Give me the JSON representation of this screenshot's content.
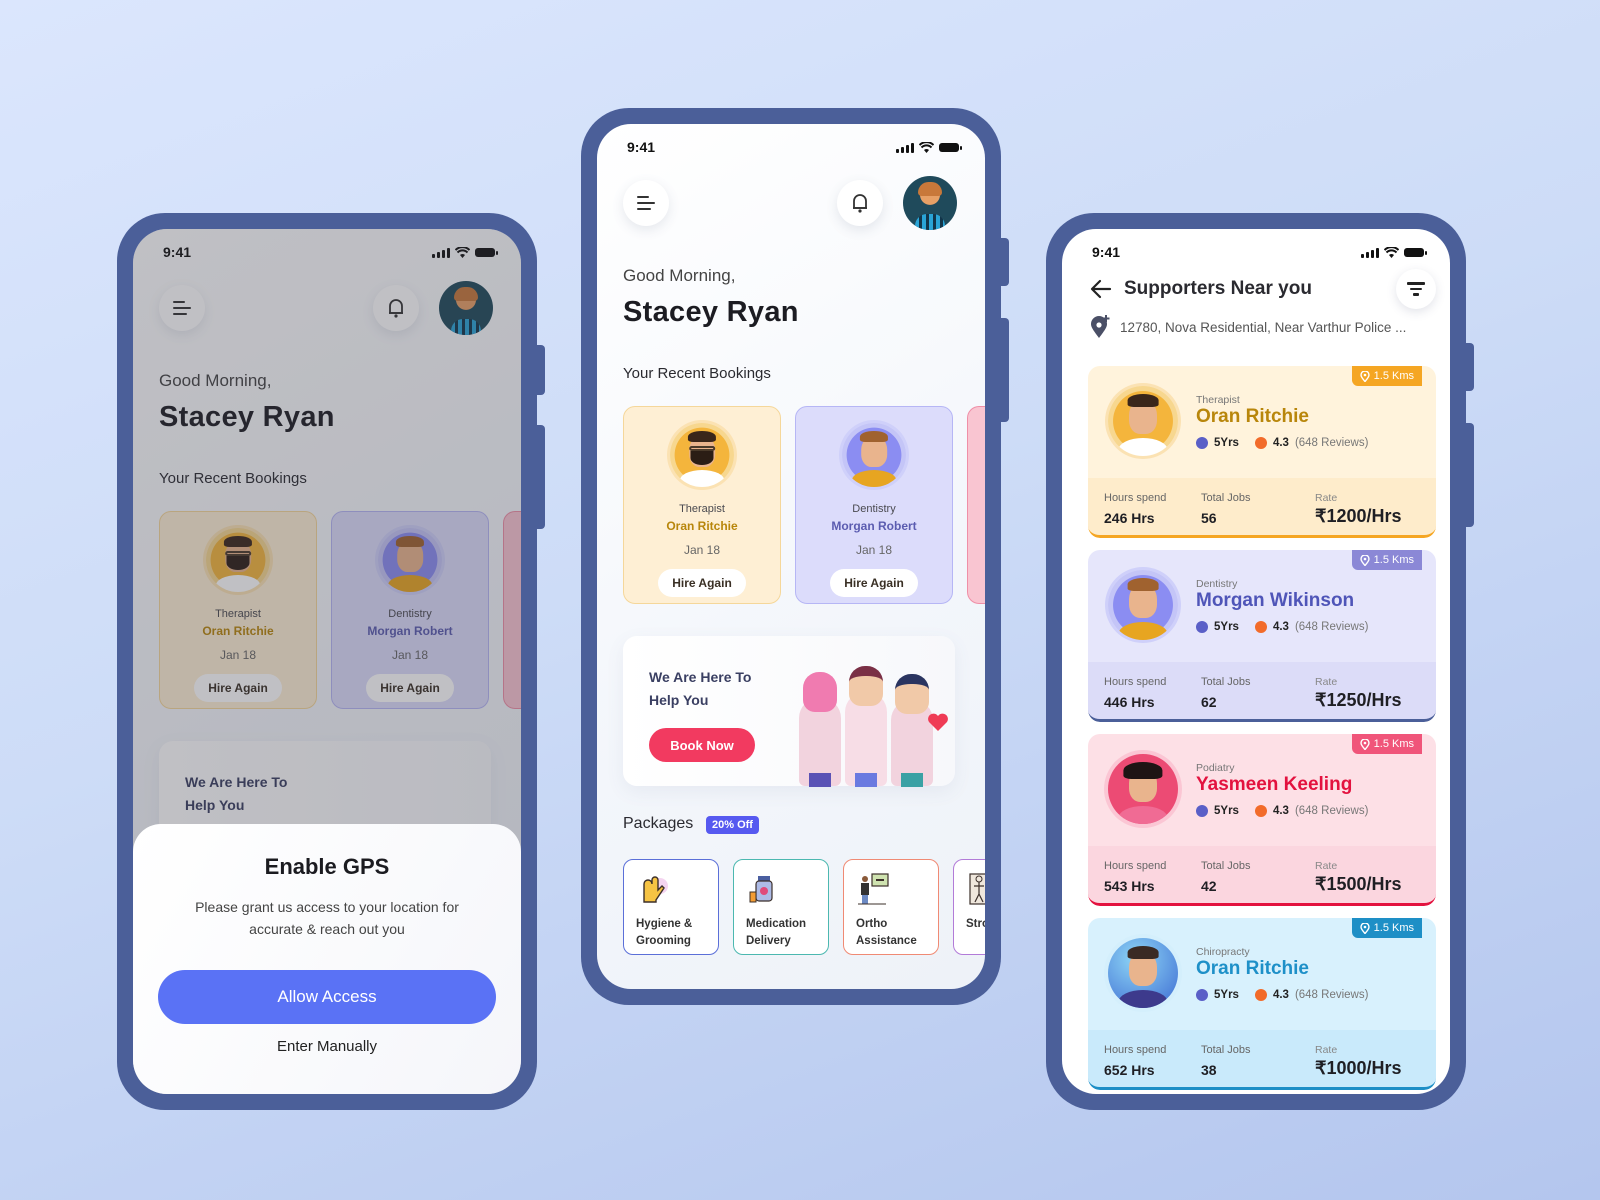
{
  "status_bar": {
    "time": "9:41"
  },
  "home": {
    "greeting": "Good Morning,",
    "user_name": "Stacey Ryan",
    "recent_bookings_title": "Your Recent Bookings",
    "bookings": [
      {
        "role": "Therapist",
        "name": "Oran Ritchie",
        "date": "Jan 18",
        "action": "Hire Again",
        "color": "#b8860b"
      },
      {
        "role": "Dentistry",
        "name": "Morgan Robert",
        "date": "Jan 18",
        "action": "Hire Again",
        "color": "#5b5cb0"
      }
    ],
    "promo": {
      "title": "We Are Here To Help You",
      "button": "Book Now"
    },
    "packages_title": "Packages",
    "packages_badge": "20% Off",
    "packages": [
      {
        "label": "Hygiene & Grooming",
        "icon": "glove-icon",
        "border": "#5b6fd8"
      },
      {
        "label": "Medication Delivery",
        "icon": "medicine-bottle-icon",
        "border": "#4cb8b0"
      },
      {
        "label": "Ortho Assistance",
        "icon": "xray-board-icon",
        "border": "#f08a74"
      },
      {
        "label": "Stroke Care",
        "icon": "skeleton-icon",
        "border": "#b27bd8"
      }
    ]
  },
  "gps_sheet": {
    "title": "Enable GPS",
    "message": "Please grant us access to your location for accurate & reach out you",
    "allow_button": "Allow Access",
    "manual_button": "Enter Manually"
  },
  "supporters": {
    "title": "Supporters Near you",
    "address": "12780, Nova Residential, Near Varthur Police ...",
    "labels": {
      "hours": "Hours spend",
      "jobs": "Total Jobs",
      "rate": "Rate"
    },
    "list": [
      {
        "role": "Therapist",
        "name": "Oran Ritchie",
        "distance": "1.5 Kms",
        "experience": "5Yrs",
        "rating": "4.3",
        "reviews": "(648 Reviews)",
        "hours": "246 Hrs",
        "jobs": "56",
        "rate": "₹1200/Hrs",
        "accent": "#b8860b",
        "badge": "#f5a623",
        "bg_top": "#fff3dc",
        "bg_bottom": "#feeccb",
        "line": "#f5a623"
      },
      {
        "role": "Dentistry",
        "name": "Morgan Wikinson",
        "distance": "1.5 Kms",
        "experience": "5Yrs",
        "rating": "4.3",
        "reviews": "(648 Reviews)",
        "hours": "446 Hrs",
        "jobs": "62",
        "rate": "₹1250/Hrs",
        "accent": "#4f55b8",
        "badge": "#8b88d6",
        "bg_top": "#e6e6fb",
        "bg_bottom": "#dcdcf8",
        "line": "#4b5f99"
      },
      {
        "role": "Podiatry",
        "name": "Yasmeen Keeling",
        "distance": "1.5 Kms",
        "experience": "5Yrs",
        "rating": "4.3",
        "reviews": "(648 Reviews)",
        "hours": "543 Hrs",
        "jobs": "42",
        "rate": "₹1500/Hrs",
        "accent": "#e3123f",
        "badge": "#f0557a",
        "bg_top": "#fde0e6",
        "bg_bottom": "#fbd6df",
        "line": "#e3123f"
      },
      {
        "role": "Chiropracty",
        "name": "Oran Ritchie",
        "distance": "1.5 Kms",
        "experience": "5Yrs",
        "rating": "4.3",
        "reviews": "(648 Reviews)",
        "hours": "652 Hrs",
        "jobs": "38",
        "rate": "₹1000/Hrs",
        "accent": "#1e90c8",
        "badge": "#1e8fc6",
        "bg_top": "#d8f1fd",
        "bg_bottom": "#c9eafb",
        "line": "#1e8fc6"
      }
    ]
  }
}
